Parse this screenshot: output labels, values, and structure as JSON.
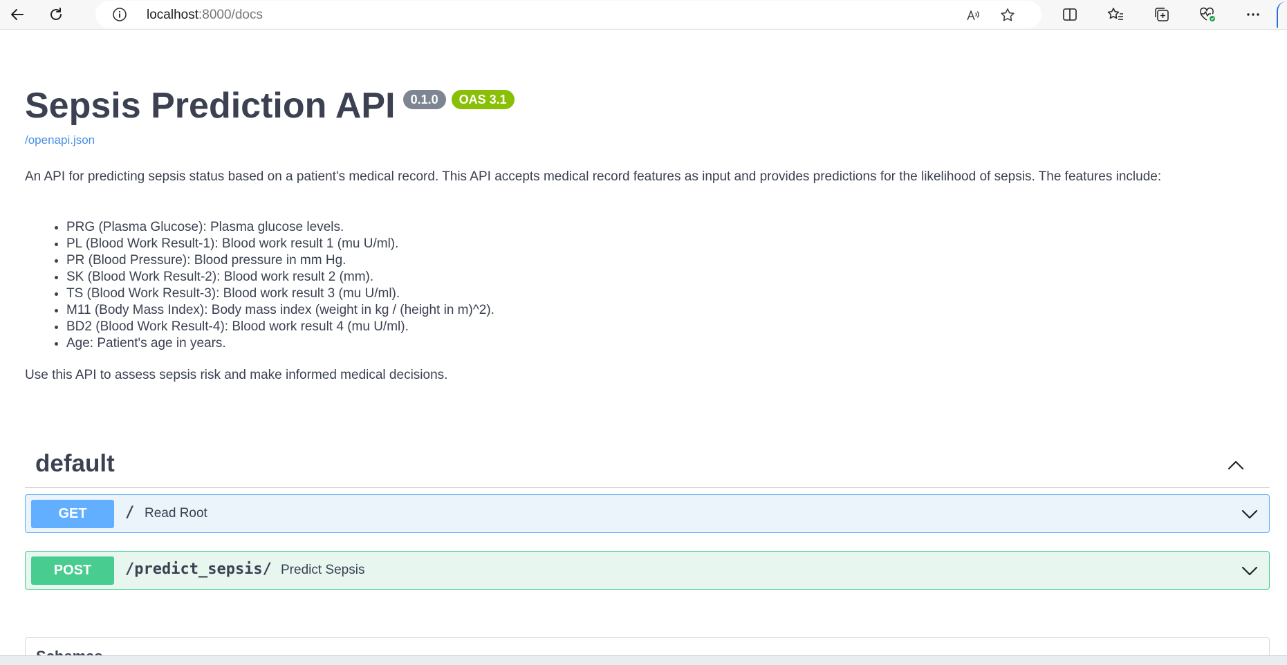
{
  "browser": {
    "url_host": "localhost",
    "url_path": ":8000/docs",
    "icons": {
      "back": "back-arrow-icon",
      "refresh": "refresh-icon",
      "info": "info-icon",
      "read_aloud": "read-aloud-icon",
      "favorite": "star-icon",
      "split_screen": "split-screen-icon",
      "favorites": "favorites-icon",
      "collections": "collections-icon",
      "browser_essentials": "heart-pulse-icon",
      "more": "more-icon"
    }
  },
  "api": {
    "title": "Sepsis Prediction API",
    "version": "0.1.0",
    "oas_badge": "OAS 3.1",
    "spec_link": "/openapi.json",
    "description": "An API for predicting sepsis status based on a patient's medical record. This API accepts medical record features as input and provides predictions for the likelihood of sepsis. The features include:",
    "features": [
      "PRG (Plasma Glucose): Plasma glucose levels.",
      "PL (Blood Work Result-1): Blood work result 1 (mu U/ml).",
      "PR (Blood Pressure): Blood pressure in mm Hg.",
      "SK (Blood Work Result-2): Blood work result 2 (mm).",
      "TS (Blood Work Result-3): Blood work result 3 (mu U/ml).",
      "M11 (Body Mass Index): Body mass index (weight in kg / (height in m)^2).",
      "BD2 (Blood Work Result-4): Blood work result 4 (mu U/ml).",
      "Age: Patient's age in years."
    ],
    "outro": "Use this API to assess sepsis risk and make informed medical decisions."
  },
  "tag": {
    "name": "default",
    "expanded": true
  },
  "operations": [
    {
      "method": "GET",
      "path": "/",
      "summary": "Read Root"
    },
    {
      "method": "POST",
      "path": "/predict_sepsis/",
      "summary": "Predict Sepsis"
    }
  ],
  "schemas": {
    "title": "Schemas"
  },
  "colors": {
    "get": "#61affe",
    "post": "#49cc90",
    "version_badge": "#7d8492",
    "oas_badge": "#89bf04",
    "link": "#4990e2"
  }
}
